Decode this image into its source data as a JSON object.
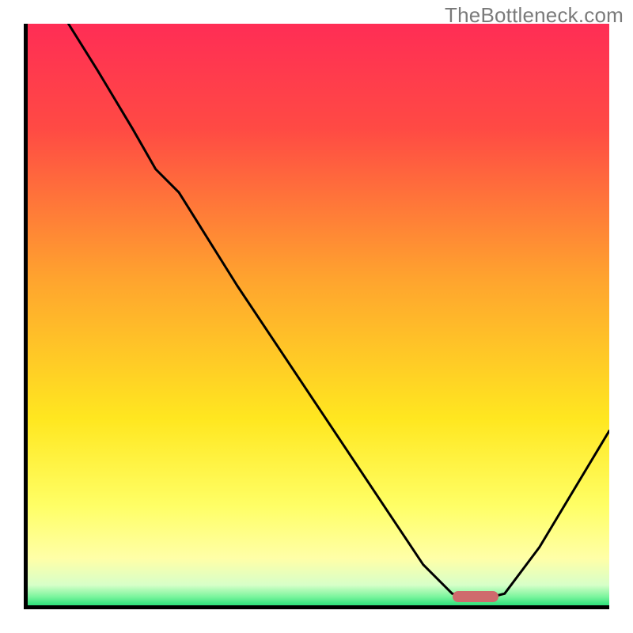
{
  "watermark": "TheBottleneck.com",
  "chart_data": {
    "type": "line",
    "title": "",
    "xlabel": "",
    "ylabel": "",
    "xlim": [
      0,
      100
    ],
    "ylim": [
      0,
      100
    ],
    "gradient_stops": [
      {
        "offset": 0,
        "color": "#ff2d55"
      },
      {
        "offset": 0.18,
        "color": "#ff4a44"
      },
      {
        "offset": 0.44,
        "color": "#ffa42e"
      },
      {
        "offset": 0.68,
        "color": "#ffe720"
      },
      {
        "offset": 0.83,
        "color": "#ffff66"
      },
      {
        "offset": 0.92,
        "color": "#ffffa8"
      },
      {
        "offset": 0.965,
        "color": "#d7ffc8"
      },
      {
        "offset": 0.985,
        "color": "#7cf59e"
      },
      {
        "offset": 1.0,
        "color": "#2de07a"
      }
    ],
    "series": [
      {
        "name": "bottleneck-curve",
        "x": [
          7,
          12,
          18,
          22,
          26,
          36,
          50,
          62,
          68,
          73,
          78,
          82,
          88,
          94,
          100
        ],
        "y": [
          100,
          92,
          82,
          75,
          71,
          55,
          34,
          16,
          7,
          2,
          1,
          2,
          10,
          20,
          30
        ]
      }
    ],
    "marker": {
      "name": "optimal-range",
      "x_start": 73,
      "x_end": 81,
      "y": 1.5,
      "color": "#cf6a6d"
    }
  }
}
